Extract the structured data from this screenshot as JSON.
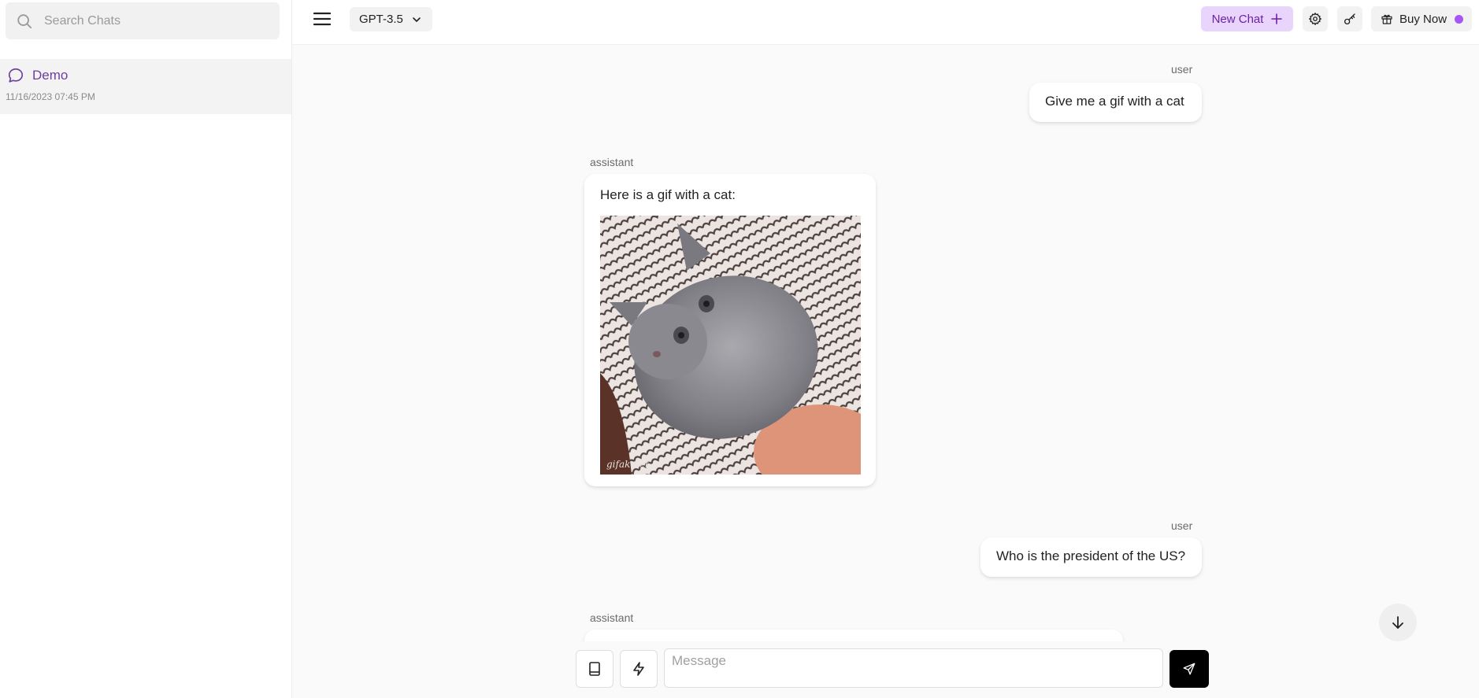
{
  "sidebar": {
    "search_placeholder": "Search Chats",
    "chats": [
      {
        "title": "Demo",
        "date": "11/16/2023 07:45 PM",
        "active": true
      }
    ]
  },
  "topbar": {
    "model": "GPT-3.5",
    "new_chat_label": "New Chat",
    "buy_label": "Buy Now"
  },
  "messages": [
    {
      "role": "user",
      "text": "Give me a gif with a cat"
    },
    {
      "role": "assistant",
      "text": "Here is a gif with a cat:",
      "image_watermark": "gifak.net"
    },
    {
      "role": "user",
      "text": "Who is the president of the US?"
    },
    {
      "role": "assistant",
      "text": ""
    }
  ],
  "composer": {
    "placeholder": "Message"
  },
  "colors": {
    "accent": "#6b21a8",
    "accent_bg": "#e9d5fb",
    "status_dot": "#a855f7",
    "send_button": "#000000"
  },
  "icons": [
    "search-icon",
    "chat-bubble-icon",
    "menu-icon",
    "chevron-down-icon",
    "plus-icon",
    "gear-icon",
    "key-icon",
    "gift-icon",
    "arrow-down-icon",
    "book-icon",
    "bolt-icon",
    "send-icon"
  ]
}
